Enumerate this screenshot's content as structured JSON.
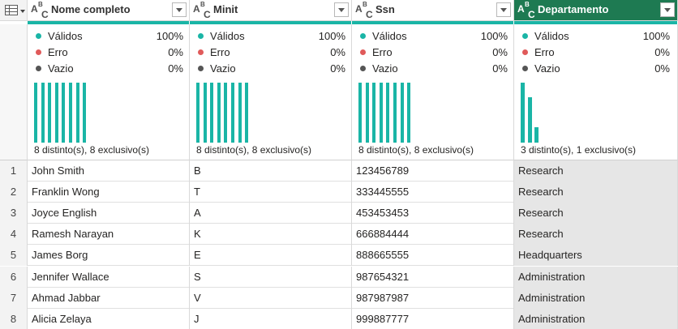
{
  "columns": [
    {
      "name": "Nome completo",
      "type_icon": "text-type-icon"
    },
    {
      "name": "Minit",
      "type_icon": "text-type-icon"
    },
    {
      "name": "Ssn",
      "type_icon": "text-type-icon"
    },
    {
      "name": "Departamento",
      "type_icon": "text-type-icon",
      "selected": true
    }
  ],
  "stat_labels": {
    "valid": "Válidos",
    "error": "Erro",
    "empty": "Vazio"
  },
  "colors": {
    "valid": "#1ab5a6",
    "error": "#e05a5a",
    "empty": "#555555",
    "selected_header": "#1e7a52"
  },
  "profiles": [
    {
      "valid": "100%",
      "error": "0%",
      "empty": "0%",
      "distinct": "8 distinto(s), 8 exclusivo(s)",
      "value_counts": [
        1,
        1,
        1,
        1,
        1,
        1,
        1,
        1
      ]
    },
    {
      "valid": "100%",
      "error": "0%",
      "empty": "0%",
      "distinct": "8 distinto(s), 8 exclusivo(s)",
      "value_counts": [
        1,
        1,
        1,
        1,
        1,
        1,
        1,
        1
      ]
    },
    {
      "valid": "100%",
      "error": "0%",
      "empty": "0%",
      "distinct": "8 distinto(s), 8 exclusivo(s)",
      "value_counts": [
        1,
        1,
        1,
        1,
        1,
        1,
        1,
        1
      ]
    },
    {
      "valid": "100%",
      "error": "0%",
      "empty": "0%",
      "distinct": "3 distinto(s), 1 exclusivo(s)",
      "value_counts": [
        4,
        3,
        1
      ]
    }
  ],
  "rows": [
    {
      "n": "1",
      "cells": [
        "John Smith",
        "B",
        "123456789",
        "Research"
      ]
    },
    {
      "n": "2",
      "cells": [
        "Franklin Wong",
        "T",
        "333445555",
        "Research"
      ]
    },
    {
      "n": "3",
      "cells": [
        "Joyce English",
        "A",
        "453453453",
        "Research"
      ]
    },
    {
      "n": "4",
      "cells": [
        "Ramesh Narayan",
        "K",
        "666884444",
        "Research"
      ]
    },
    {
      "n": "5",
      "cells": [
        "James Borg",
        "E",
        "888665555",
        "Headquarters"
      ]
    },
    {
      "n": "6",
      "cells": [
        "Jennifer Wallace",
        "S",
        "987654321",
        "Administration"
      ]
    },
    {
      "n": "7",
      "cells": [
        "Ahmad Jabbar",
        "V",
        "987987987",
        "Administration"
      ]
    },
    {
      "n": "8",
      "cells": [
        "Alicia Zelaya",
        "J",
        "999887777",
        "Administration"
      ]
    }
  ]
}
